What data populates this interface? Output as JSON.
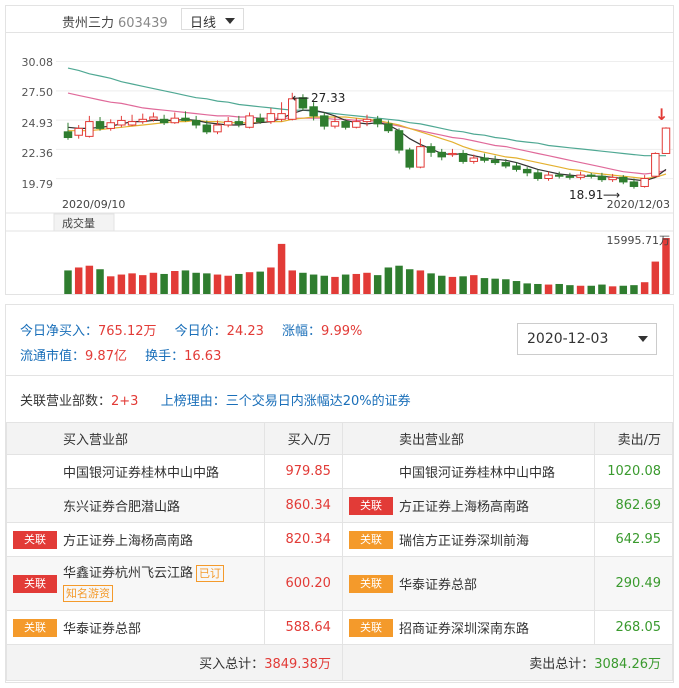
{
  "header": {
    "stock_name": "贵州三力",
    "stock_code": "603439",
    "period": "日线"
  },
  "chart": {
    "price_ticks": [
      "30.08",
      "27.50",
      "24.93",
      "22.36",
      "19.79"
    ],
    "date_start": "2020/09/10",
    "date_end": "2020/12/03",
    "high_label": "27.33",
    "low_label": "18.91",
    "volume_label": "成交量",
    "volume_max": "15995.71万",
    "colors": {
      "up": "#e23b37",
      "down": "#2f7d2f",
      "ma5": "#333333",
      "ma10": "#e4b130",
      "ma20": "#e06a9a",
      "ma60": "#4fa893"
    }
  },
  "chart_data": {
    "type": "candlestick",
    "ylim": [
      18,
      31
    ],
    "candles": [
      {
        "o": 23.9,
        "c": 23.4,
        "h": 24.7,
        "l": 23.2
      },
      {
        "o": 23.6,
        "c": 24.2,
        "h": 24.5,
        "l": 23.3
      },
      {
        "o": 23.5,
        "c": 24.8,
        "h": 25.3,
        "l": 23.4
      },
      {
        "o": 24.8,
        "c": 24.2,
        "h": 25.2,
        "l": 24.0
      },
      {
        "o": 24.2,
        "c": 24.7,
        "h": 25.0,
        "l": 24.0
      },
      {
        "o": 24.5,
        "c": 24.9,
        "h": 25.3,
        "l": 24.3
      },
      {
        "o": 24.5,
        "c": 24.8,
        "h": 25.4,
        "l": 24.4
      },
      {
        "o": 24.8,
        "c": 25.0,
        "h": 25.5,
        "l": 24.6
      },
      {
        "o": 25.0,
        "c": 25.2,
        "h": 25.6,
        "l": 24.8
      },
      {
        "o": 25.0,
        "c": 24.7,
        "h": 25.4,
        "l": 24.5
      },
      {
        "o": 24.7,
        "c": 25.1,
        "h": 25.6,
        "l": 24.6
      },
      {
        "o": 25.1,
        "c": 24.9,
        "h": 25.7,
        "l": 24.8
      },
      {
        "o": 24.9,
        "c": 24.5,
        "h": 25.3,
        "l": 24.2
      },
      {
        "o": 24.5,
        "c": 23.9,
        "h": 24.9,
        "l": 23.7
      },
      {
        "o": 23.9,
        "c": 24.5,
        "h": 24.9,
        "l": 23.7
      },
      {
        "o": 24.5,
        "c": 24.8,
        "h": 25.2,
        "l": 24.3
      },
      {
        "o": 24.8,
        "c": 24.6,
        "h": 25.3,
        "l": 24.3
      },
      {
        "o": 24.3,
        "c": 25.3,
        "h": 25.6,
        "l": 24.2
      },
      {
        "o": 25.1,
        "c": 24.8,
        "h": 25.5,
        "l": 24.6
      },
      {
        "o": 24.8,
        "c": 25.5,
        "h": 26.0,
        "l": 24.6
      },
      {
        "o": 25.0,
        "c": 25.5,
        "h": 26.5,
        "l": 24.8
      },
      {
        "o": 25.0,
        "c": 26.8,
        "h": 27.33,
        "l": 24.9
      },
      {
        "o": 26.9,
        "c": 26.0,
        "h": 27.2,
        "l": 25.8
      },
      {
        "o": 26.1,
        "c": 25.3,
        "h": 26.5,
        "l": 24.9
      },
      {
        "o": 25.3,
        "c": 24.4,
        "h": 25.6,
        "l": 24.1
      },
      {
        "o": 24.4,
        "c": 24.8,
        "h": 25.2,
        "l": 24.2
      },
      {
        "o": 24.8,
        "c": 24.3,
        "h": 25.0,
        "l": 24.1
      },
      {
        "o": 24.3,
        "c": 24.8,
        "h": 25.1,
        "l": 24.2
      },
      {
        "o": 24.8,
        "c": 25.0,
        "h": 25.4,
        "l": 24.4
      },
      {
        "o": 25.0,
        "c": 24.6,
        "h": 25.3,
        "l": 24.3
      },
      {
        "o": 24.6,
        "c": 24.0,
        "h": 24.9,
        "l": 23.8
      },
      {
        "o": 24.0,
        "c": 22.3,
        "h": 24.2,
        "l": 22.0
      },
      {
        "o": 22.3,
        "c": 20.8,
        "h": 22.5,
        "l": 20.6
      },
      {
        "o": 20.8,
        "c": 22.6,
        "h": 23.3,
        "l": 20.7
      },
      {
        "o": 22.6,
        "c": 22.1,
        "h": 22.9,
        "l": 21.7
      },
      {
        "o": 22.1,
        "c": 21.7,
        "h": 22.4,
        "l": 21.4
      },
      {
        "o": 21.9,
        "c": 22.0,
        "h": 22.4,
        "l": 21.7
      },
      {
        "o": 22.0,
        "c": 21.3,
        "h": 22.3,
        "l": 21.1
      },
      {
        "o": 21.3,
        "c": 21.6,
        "h": 21.9,
        "l": 21.1
      },
      {
        "o": 21.6,
        "c": 21.4,
        "h": 22.0,
        "l": 21.2
      },
      {
        "o": 21.4,
        "c": 21.2,
        "h": 21.8,
        "l": 21.0
      },
      {
        "o": 21.2,
        "c": 20.9,
        "h": 21.5,
        "l": 20.7
      },
      {
        "o": 20.9,
        "c": 20.6,
        "h": 21.2,
        "l": 20.4
      },
      {
        "o": 20.6,
        "c": 20.3,
        "h": 20.8,
        "l": 20.0
      },
      {
        "o": 20.3,
        "c": 19.8,
        "h": 20.6,
        "l": 19.6
      },
      {
        "o": 19.8,
        "c": 20.1,
        "h": 20.4,
        "l": 19.6
      },
      {
        "o": 20.1,
        "c": 20.0,
        "h": 20.4,
        "l": 19.8
      },
      {
        "o": 20.0,
        "c": 19.9,
        "h": 20.3,
        "l": 19.7
      },
      {
        "o": 19.9,
        "c": 20.1,
        "h": 20.4,
        "l": 19.7
      },
      {
        "o": 20.1,
        "c": 20.0,
        "h": 20.3,
        "l": 19.8
      },
      {
        "o": 20.0,
        "c": 19.7,
        "h": 20.3,
        "l": 19.5
      },
      {
        "o": 19.7,
        "c": 19.9,
        "h": 20.2,
        "l": 19.5
      },
      {
        "o": 19.9,
        "c": 19.5,
        "h": 20.1,
        "l": 19.3
      },
      {
        "o": 19.5,
        "c": 19.1,
        "h": 19.8,
        "l": 18.91
      },
      {
        "o": 19.1,
        "c": 19.8,
        "h": 20.1,
        "l": 19.0
      },
      {
        "o": 20.0,
        "c": 22.0,
        "h": 22.1,
        "l": 19.9
      },
      {
        "o": 22.0,
        "c": 24.23,
        "h": 24.3,
        "l": 22.0
      }
    ],
    "volume": [
      40,
      45,
      48,
      42,
      30,
      33,
      35,
      32,
      36,
      34,
      39,
      40,
      36,
      35,
      33,
      31,
      34,
      37,
      38,
      45,
      85,
      40,
      36,
      33,
      31,
      29,
      33,
      34,
      36,
      32,
      45,
      48,
      42,
      40,
      35,
      31,
      29,
      30,
      32,
      27,
      26,
      25,
      22,
      18,
      17,
      16,
      17,
      15,
      14,
      14,
      16,
      13,
      14,
      15,
      20,
      55,
      95
    ],
    "ma5": [
      24.3,
      24.2,
      24.2,
      24.3,
      24.4,
      24.6,
      24.8,
      24.8,
      24.9,
      24.9,
      24.9,
      25.0,
      24.9,
      24.7,
      24.6,
      24.5,
      24.5,
      24.6,
      24.7,
      24.8,
      25.1,
      25.5,
      25.8,
      25.8,
      25.6,
      25.3,
      24.9,
      24.7,
      24.6,
      24.7,
      24.5,
      24.0,
      23.3,
      22.8,
      22.4,
      22.0,
      21.9,
      22.0,
      21.8,
      21.6,
      21.5,
      21.4,
      21.2,
      20.9,
      20.6,
      20.4,
      20.2,
      20.1,
      20.0,
      20.0,
      20.0,
      19.9,
      19.8,
      19.7,
      19.6,
      19.9,
      20.6
    ],
    "ma10": [
      24.0,
      24.0,
      24.0,
      24.1,
      24.2,
      24.3,
      24.4,
      24.5,
      24.6,
      24.7,
      24.8,
      24.8,
      24.9,
      24.8,
      24.8,
      24.7,
      24.7,
      24.7,
      24.7,
      24.8,
      24.8,
      25.0,
      25.1,
      25.2,
      25.2,
      25.2,
      25.2,
      25.1,
      25.0,
      24.9,
      24.7,
      24.5,
      24.2,
      23.9,
      23.6,
      23.3,
      23.0,
      22.6,
      22.3,
      22.1,
      21.9,
      21.7,
      21.6,
      21.4,
      21.2,
      21.0,
      20.8,
      20.6,
      20.5,
      20.3,
      20.2,
      20.1,
      20.0,
      19.9,
      19.8,
      19.9,
      20.2
    ],
    "ma20": [
      27.3,
      27.1,
      26.9,
      26.7,
      26.5,
      26.4,
      26.2,
      26.0,
      25.9,
      25.8,
      25.7,
      25.6,
      25.5,
      25.4,
      25.3,
      25.3,
      25.2,
      25.2,
      25.1,
      25.1,
      25.1,
      25.1,
      25.1,
      25.1,
      25.1,
      25.0,
      25.0,
      24.9,
      24.9,
      24.8,
      24.6,
      24.4,
      24.2,
      24.0,
      23.8,
      23.6,
      23.4,
      23.3,
      23.1,
      22.9,
      22.7,
      22.6,
      22.4,
      22.2,
      22.0,
      21.8,
      21.6,
      21.4,
      21.2,
      21.0,
      20.8,
      20.6,
      20.4,
      20.3,
      20.2,
      20.3,
      20.5
    ],
    "ma60": [
      29.5,
      29.3,
      29.0,
      28.8,
      28.6,
      28.3,
      28.1,
      27.9,
      27.7,
      27.5,
      27.3,
      27.1,
      26.9,
      26.8,
      26.6,
      26.5,
      26.3,
      26.2,
      26.1,
      26.0,
      25.9,
      25.8,
      25.8,
      25.7,
      25.6,
      25.5,
      25.4,
      25.3,
      25.2,
      25.1,
      25.0,
      24.9,
      24.7,
      24.6,
      24.4,
      24.2,
      24.0,
      23.9,
      23.7,
      23.6,
      23.4,
      23.3,
      23.1,
      23.0,
      22.9,
      22.7,
      22.6,
      22.5,
      22.4,
      22.3,
      22.2,
      22.1,
      22.0,
      21.9,
      21.8,
      21.8,
      21.8
    ]
  },
  "summary": {
    "net_buy_label": "今日净买入：",
    "net_buy_value": "765.12万",
    "price_label": "今日价：",
    "price_value": "24.23",
    "change_label": "涨幅：",
    "change_value": "9.99%",
    "market_cap_label": "流通市值：",
    "market_cap_value": "9.87亿",
    "turnover_label": "换手：",
    "turnover_value": "16.63"
  },
  "date_select": {
    "value": "2020-12-03"
  },
  "reason": {
    "dept_label": "关联营业部数：",
    "dept_value": "2+3",
    "reason_label": "上榜理由：",
    "reason_value": "三个交易日内涨幅达20%的证券"
  },
  "table": {
    "buy_header": "买入营业部",
    "buy_amt_header": "买入/万",
    "sell_header": "卖出营业部",
    "sell_amt_header": "卖出/万",
    "rows": [
      {
        "buy_badge": "",
        "buy_name": "中国银河证券桂林中山中路",
        "buy_tag1": "",
        "buy_tag2": "",
        "buy_amt": "979.85",
        "sell_badge": "",
        "sell_name": "中国银河证券桂林中山中路",
        "sell_amt": "1020.08"
      },
      {
        "buy_badge": "",
        "buy_name": "东兴证券合肥潜山路",
        "buy_tag1": "",
        "buy_tag2": "",
        "buy_amt": "860.34",
        "sell_badge": "关联",
        "sell_name": "方正证券上海杨高南路",
        "sell_amt": "862.69"
      },
      {
        "buy_badge": "关联",
        "buy_name": "方正证券上海杨高南路",
        "buy_tag1": "",
        "buy_tag2": "",
        "buy_amt": "820.34",
        "sell_badge": "关联",
        "sell_name": "瑞信方正证券深圳前海",
        "sell_amt": "642.95"
      },
      {
        "buy_badge": "关联",
        "buy_name": "华鑫证券杭州飞云江路",
        "buy_tag1": "已订",
        "buy_tag2": "知名游资",
        "buy_amt": "600.20",
        "sell_badge": "关联",
        "sell_name": "华泰证券总部",
        "sell_amt": "290.49"
      },
      {
        "buy_badge": "关联",
        "buy_name": "华泰证券总部",
        "buy_tag1": "",
        "buy_tag2": "",
        "buy_amt": "588.64",
        "sell_badge": "关联",
        "sell_name": "招商证券深圳深南东路",
        "sell_amt": "268.05"
      }
    ],
    "buy_total_label": "买入总计：",
    "buy_total_value": "3849.38万",
    "sell_total_label": "卖出总计：",
    "sell_total_value": "3084.26万"
  }
}
